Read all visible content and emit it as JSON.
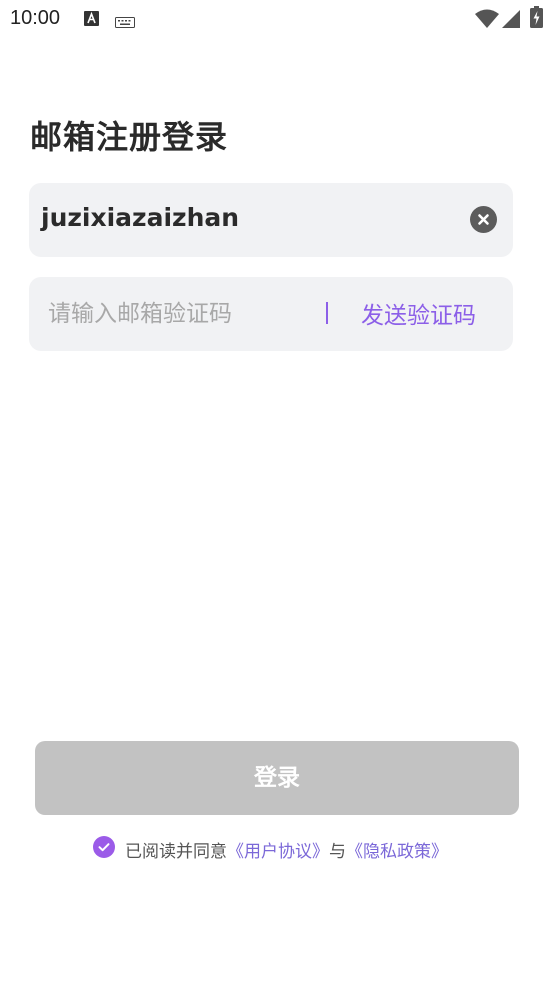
{
  "status_bar": {
    "time": "10:00",
    "icons": [
      "text-a-icon",
      "keyboard-icon",
      "wifi-icon",
      "cellular-signal-icon",
      "battery-charging-icon"
    ]
  },
  "page": {
    "title": "邮箱注册登录"
  },
  "email_field": {
    "value": "juzixiazaizhan",
    "clear_icon": "close-circle-icon"
  },
  "code_field": {
    "placeholder": "请输入邮箱验证码",
    "divider": "|",
    "send_label": "发送验证码"
  },
  "login_button": {
    "label": "登录",
    "state": "disabled"
  },
  "agreement": {
    "checked": true,
    "prefix": "已阅读并同意",
    "terms_link": "《用户协议》",
    "conjunction": "与",
    "privacy_link": "《隐私政策》"
  },
  "colors": {
    "accent": "#8c5fe8",
    "link": "#7b68d8",
    "field_bg": "#f1f2f4",
    "button_disabled": "#c2c2c2"
  }
}
